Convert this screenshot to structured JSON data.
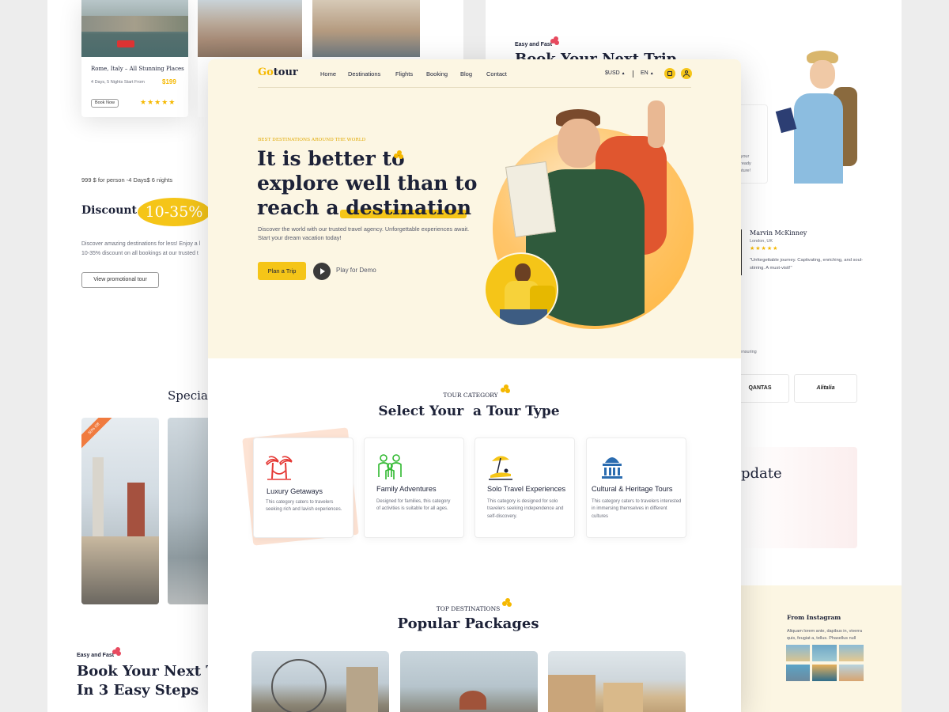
{
  "brand": {
    "name_part1": "Go",
    "name_part2": "tour",
    "accent": "#f5c518",
    "dark": "#1d2238"
  },
  "nav": {
    "items": [
      "Home",
      "Destinations",
      "Flights",
      "Booking",
      "Blog",
      "Contact"
    ],
    "currency": "$USD",
    "language": "EN",
    "icons": [
      "shopping-bag-icon",
      "user-icon"
    ]
  },
  "hero": {
    "eyebrow": "BEST DESTINATIONS AROUND THE WORLD",
    "headline_line1": "It is better to",
    "headline_line2": "explore well than to",
    "headline_line3_pre": "reach a ",
    "headline_line3_highlight": "destination",
    "description": "Discover the world with our trusted travel agency. Unforgettable experiences await. Start your dream vacation today!",
    "cta_label": "Plan a Trip",
    "demo_label": "Play for Demo"
  },
  "tour_category": {
    "eyebrow": "TOUR CATEGORY",
    "title": "Select Your  a Tour Type",
    "cards": [
      {
        "title": "Luxury Getaways",
        "icon": "palm-trees-hammock-icon",
        "desc": "This category caters to travelers seeking rich and lavish experiences."
      },
      {
        "title": "Family Adventures",
        "icon": "family-icon",
        "desc": "Designed for families, this category of activities is suitable for all ages."
      },
      {
        "title": "Solo Travel Experiences",
        "icon": "beach-umbrella-icon",
        "desc": "This category is designed for solo travelers seeking independence and self-discovery."
      },
      {
        "title": "Cultural & Heritage Tours",
        "icon": "temple-icon",
        "desc": "This category caters to travelers interested in immersing themselves in different cultures"
      }
    ]
  },
  "top_destinations": {
    "eyebrow": "TOP DESTINATIONS",
    "title": "Popular Packages"
  },
  "left_page": {
    "tour_card": {
      "title": "Rome, Italy – All Stunning Places",
      "meta": "4 Days, 5 Nights Start From",
      "price": "$199",
      "button": "Book Now",
      "rating": 5
    },
    "promo_meta": "999 $ for person -4 Days$ 6 nights",
    "discount_label": "Discount",
    "discount_value": "10-35%",
    "promo_text_line1": "Discover amazing destinations for less! Enjoy a l",
    "promo_text_line2": "10-35% discount on all bookings at our trusted t",
    "promo_button": "View promotional tour",
    "special_heading": "Special",
    "badge": "50% Off",
    "steps_eyebrow": "Easy and Fast",
    "steps_line1": "Book Your Next Tri",
    "steps_line2": "In 3 Easy Steps"
  },
  "right_page": {
    "eyebrow": "Easy and Fast",
    "heading": "Book Your Next Trip",
    "snippet": [
      "n your",
      "ready",
      "enture!"
    ],
    "testimonial": {
      "name": "Marvin McKinney",
      "location": "London, UK",
      "rating": 5,
      "quote": "\"Unforgettable journey. Captivating, enriching, and soul-stirring. A must-visit!\""
    },
    "partners_caption": "rs, ensuring",
    "partners": [
      "QANTAS",
      "Alitalia"
    ],
    "update_heading": "pdate",
    "instagram": {
      "title": "From Instagram",
      "text": "Aliquam lorem ante, dapibus in, viverra quis, feugiat a, tellus. Phasellus null"
    }
  }
}
